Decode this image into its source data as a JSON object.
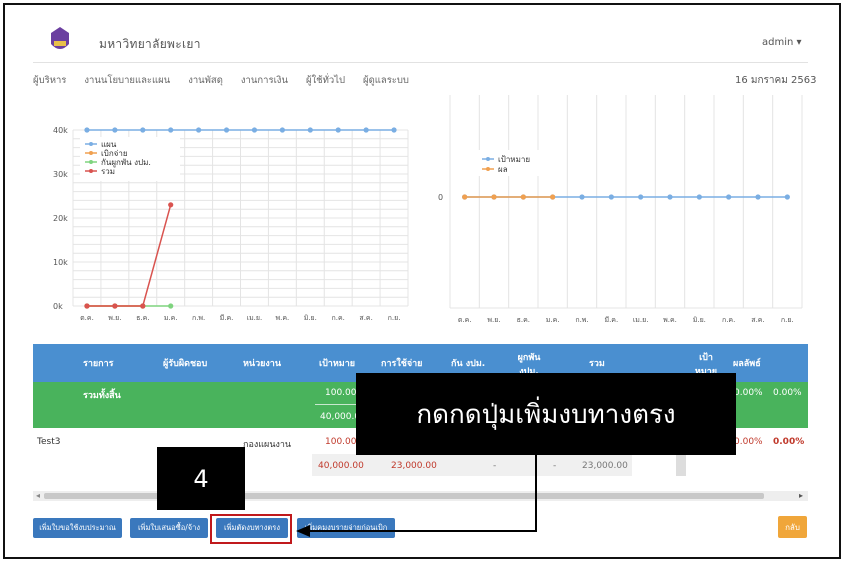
{
  "header": {
    "university": "มหาวิทยาลัยพะเยา",
    "admin": "admin ▾",
    "date": "16 มกราคม 2563",
    "nav": [
      "ผู้บริหาร",
      "งานนโยบายและแผน",
      "งานพัสดุ",
      "งานการเงิน",
      "ผู้ใช้ทั่วไป",
      "ผู้ดูแลระบบ"
    ]
  },
  "chart_data": [
    {
      "type": "line",
      "categories": [
        "ต.ค.",
        "พ.ย.",
        "ธ.ค.",
        "ม.ค.",
        "ก.พ.",
        "มี.ค.",
        "เม.ย.",
        "พ.ค.",
        "มิ.ย.",
        "ก.ค.",
        "ส.ค.",
        "ก.ย."
      ],
      "ylim": [
        0,
        40000
      ],
      "yticks": [
        "0k",
        "10k",
        "20k",
        "30k",
        "40k"
      ],
      "series": [
        {
          "name": "แผน",
          "color": "#7aaee3",
          "values": [
            40000,
            40000,
            40000,
            40000,
            40000,
            40000,
            40000,
            40000,
            40000,
            40000,
            40000,
            40000
          ]
        },
        {
          "name": "เบิกจ่าย",
          "color": "#f0a050",
          "values": [
            0,
            0,
            0,
            null,
            null,
            null,
            null,
            null,
            null,
            null,
            null,
            null
          ]
        },
        {
          "name": "กันผูกพัน งปม.",
          "color": "#7fd47f",
          "values": [
            0,
            0,
            0,
            0,
            null,
            null,
            null,
            null,
            null,
            null,
            null,
            null
          ]
        },
        {
          "name": "รวม",
          "color": "#d9534f",
          "values": [
            0,
            0,
            0,
            23000,
            null,
            null,
            null,
            null,
            null,
            null,
            null,
            null
          ]
        }
      ],
      "legend_position": "top-left"
    },
    {
      "type": "line",
      "categories": [
        "ต.ค.",
        "พ.ย.",
        "ธ.ค.",
        "ม.ค.",
        "ก.พ.",
        "มี.ค.",
        "เม.ย.",
        "พ.ค.",
        "มิ.ย.",
        "ก.ค.",
        "ส.ค.",
        "ก.ย."
      ],
      "yticks": [
        "0"
      ],
      "series": [
        {
          "name": "เป้าหมาย",
          "color": "#7aaee3",
          "values": [
            0,
            0,
            0,
            0,
            0,
            0,
            0,
            0,
            0,
            0,
            0,
            0
          ]
        },
        {
          "name": "ผล",
          "color": "#f0a050",
          "values": [
            0,
            0,
            0,
            0,
            null,
            null,
            null,
            null,
            null,
            null,
            null,
            null
          ]
        }
      ],
      "legend_position": "top-left"
    }
  ],
  "table": {
    "headers": [
      "รายการ",
      "ผู้รับผิดชอบ",
      "หน่วยงาน",
      "เป้าหมาย",
      "การใช้จ่าย",
      "กัน งปม.",
      "ผูกพัน งปม.",
      "รวม",
      "เป้า หมาย",
      "ผลลัพธ์"
    ],
    "total_label": "รวมทั้งสิ้น",
    "total_row1": {
      "target": "100.00",
      "pct1": "0.00%",
      "pct2": "0.00%"
    },
    "total_row2": {
      "target": "40,000.00"
    },
    "row": {
      "name": "Test3",
      "unit": "กองแผนงาน",
      "target": "100.00",
      "pct1": "0.00%",
      "pct2": "0.00%"
    },
    "row2": {
      "target": "40,000.00",
      "spent": "23,000.00",
      "reserve": "-",
      "commit": "-",
      "sum": "23,000.00"
    }
  },
  "buttons": {
    "b1": "เพิ่มใบขอใช้งบประมาณ",
    "b2": "เพิ่มใบเสนอซื้อ/จ้าง",
    "b3": "เพิ่มตัดงบทางตรง",
    "b4": "เพิ่มคุมงบรายจ่ายก่อนเบิก",
    "back": "กลับ"
  },
  "annotation": {
    "step": "4",
    "callout": "กดกดปุ่มเพิ่มงบทางตรง"
  }
}
